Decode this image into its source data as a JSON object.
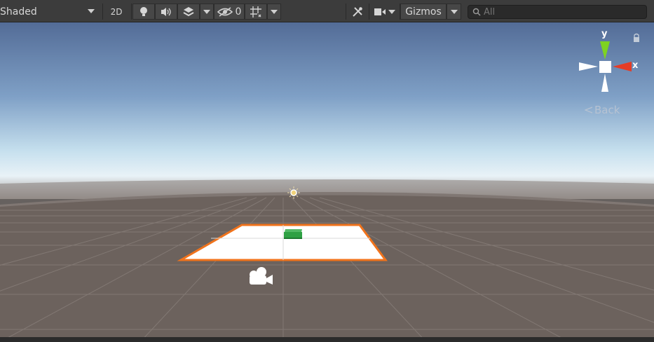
{
  "toolbar": {
    "shading_mode": "Shaded",
    "mode_2d_label": "2D",
    "hidden_count": "0",
    "gizmos_label": "Gizmos",
    "search_placeholder": "All"
  },
  "icons": {
    "shading_dropdown": "chevron-down-icon",
    "lighting": "lightbulb-icon",
    "audio": "speaker-icon",
    "effects": "effects-stack-icon",
    "visibility": "eye-slash-icon",
    "grid": "grid-snap-icon",
    "tools": "tools-icon",
    "camera": "video-camera-icon",
    "search": "search-icon",
    "lock": "lock-icon",
    "scene_camera": "scene-camera-gizmo-icon",
    "light": "sun-light-gizmo-icon"
  },
  "orientation_gizmo": {
    "y_label": "y",
    "x_label": "x",
    "back_label": "Back",
    "colors": {
      "y_axis": "#7ed321",
      "x_axis": "#e53c26",
      "neutral": "#ffffff"
    }
  },
  "scene": {
    "colors": {
      "sky_top": "#536c97",
      "horizon": "#e9f2f7",
      "ground": "#6c625d",
      "grid_line": "#867d78",
      "plane_fill": "#ffffff",
      "selection_outline": "#f0731c",
      "cube": "#2ea043"
    }
  }
}
